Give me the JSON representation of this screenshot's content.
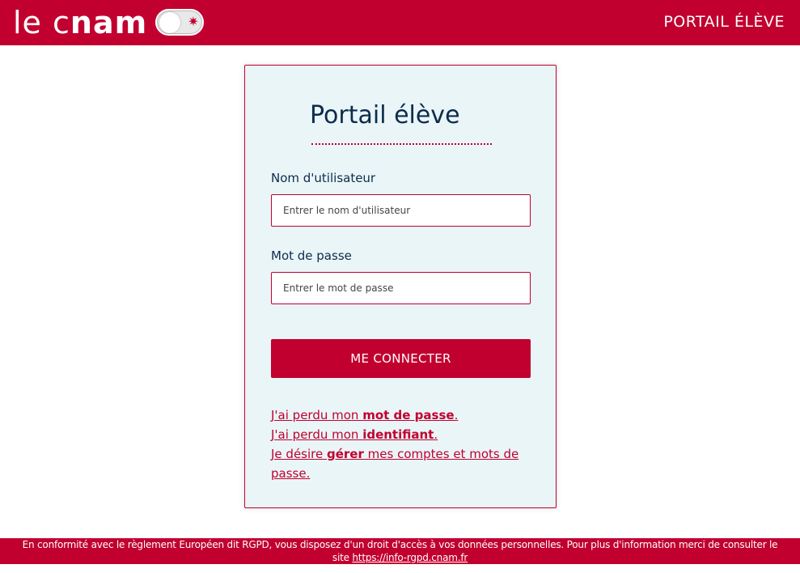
{
  "header": {
    "logo_prefix": "le c",
    "logo_bold": "nam",
    "toggle_icon": "sun-icon",
    "portal_title": "PORTAIL ÉLÈVE"
  },
  "card": {
    "title": "Portail élève",
    "username": {
      "label": "Nom d'utilisateur",
      "placeholder": "Entrer le nom d'utilisateur",
      "value": ""
    },
    "password": {
      "label": "Mot de passe",
      "placeholder": "Entrer le mot de passe",
      "value": ""
    },
    "login_button": "ME CONNECTER",
    "links": {
      "lost_password_prefix": "J'ai perdu mon ",
      "lost_password_bold": "mot de passe",
      "lost_password_suffix": ".",
      "lost_id_prefix": "J'ai perdu mon ",
      "lost_id_bold": "identifiant",
      "lost_id_suffix": ".",
      "manage_prefix": "Je désire ",
      "manage_bold": "gérer",
      "manage_suffix": " mes comptes et mots de passe."
    }
  },
  "footer": {
    "text": "En conformité avec le règlement Européen dit RGPD, vous disposez d'un droit d'accès à vos données personnelles. Pour plus d'information merci de consulter le site ",
    "link": "https://info-rgpd.cnam.fr"
  },
  "colors": {
    "brand": "#c1002f",
    "card_bg": "#eaf5f7",
    "title": "#0c2c4c"
  }
}
